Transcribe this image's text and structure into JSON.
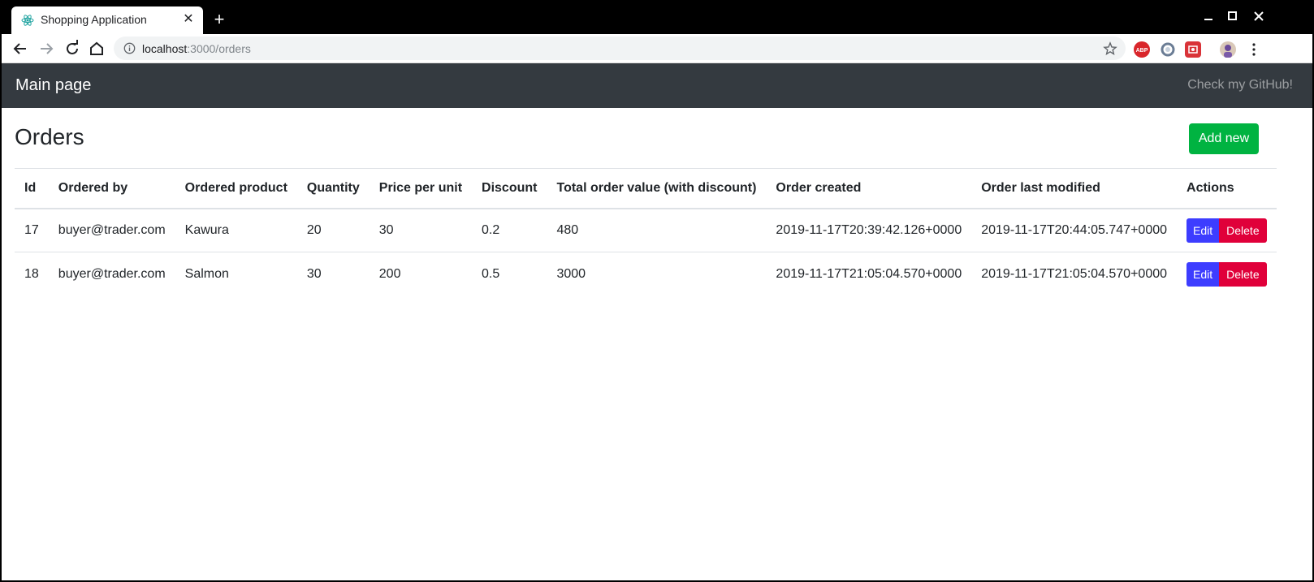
{
  "browser": {
    "tab_title": "Shopping Application",
    "url_host": "localhost",
    "url_path": ":3000/orders",
    "extensions": [
      {
        "name": "adblock-plus-icon",
        "color": "#d9262b"
      },
      {
        "name": "extension-ring-icon",
        "color": "#6b7d95"
      },
      {
        "name": "extension-red-icon",
        "color": "#d93338"
      }
    ]
  },
  "navbar": {
    "brand": "Main page",
    "github_link": "Check my GitHub!"
  },
  "page": {
    "title": "Orders",
    "add_button": "Add new"
  },
  "table": {
    "headers": [
      "Id",
      "Ordered by",
      "Ordered product",
      "Quantity",
      "Price per unit",
      "Discount",
      "Total order value (with discount)",
      "Order created",
      "Order last modified",
      "Actions"
    ],
    "rows": [
      {
        "id": "17",
        "ordered_by": "buyer@trader.com",
        "product": "Kawura",
        "quantity": "20",
        "price": "30",
        "discount": "0.2",
        "total": "480",
        "created": "2019-11-17T20:39:42.126+0000",
        "modified": "2019-11-17T20:44:05.747+0000"
      },
      {
        "id": "18",
        "ordered_by": "buyer@trader.com",
        "product": "Salmon",
        "quantity": "30",
        "price": "200",
        "discount": "0.5",
        "total": "3000",
        "created": "2019-11-17T21:05:04.570+0000",
        "modified": "2019-11-17T21:05:04.570+0000"
      }
    ],
    "edit_label": "Edit",
    "delete_label": "Delete"
  }
}
